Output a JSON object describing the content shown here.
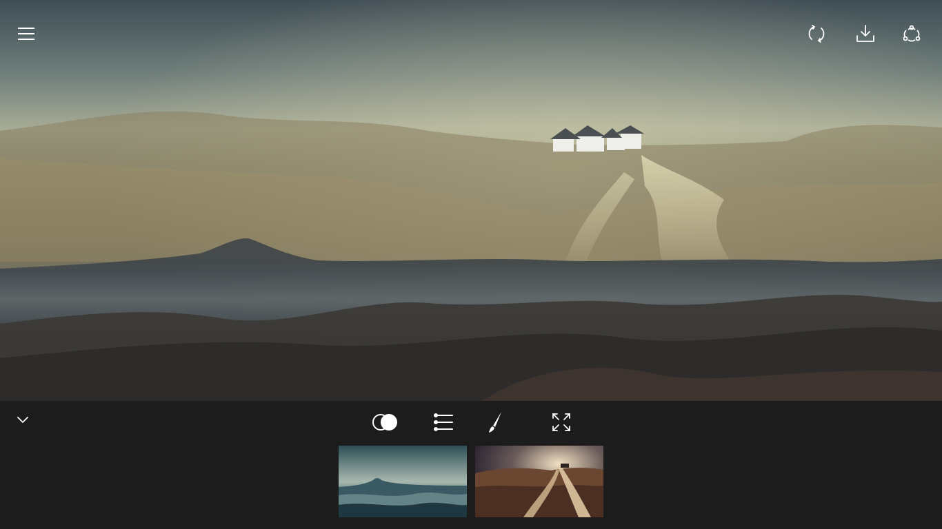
{
  "app": {
    "view": "photo-blend-editor"
  },
  "toolbar_top": {
    "menu_icon": "hamburger-menu-icon",
    "sync_icon": "sync-icon",
    "save_icon": "download-icon",
    "share_icon": "share-icon"
  },
  "canvas": {
    "description_icon": "blended-image"
  },
  "bottom_panel": {
    "collapse_icon": "chevron-down-icon",
    "tools": [
      {
        "name": "blend-mode",
        "icon": "blend-circles-icon"
      },
      {
        "name": "adjust",
        "icon": "sliders-icon"
      },
      {
        "name": "brush",
        "icon": "brush-icon"
      },
      {
        "name": "expand",
        "icon": "expand-icon"
      }
    ],
    "layers": [
      {
        "name": "layer-misty-mountains"
      },
      {
        "name": "layer-dune-path"
      }
    ]
  },
  "colors": {
    "panel_bg": "#1c1c1c",
    "icon": "#ffffff"
  }
}
